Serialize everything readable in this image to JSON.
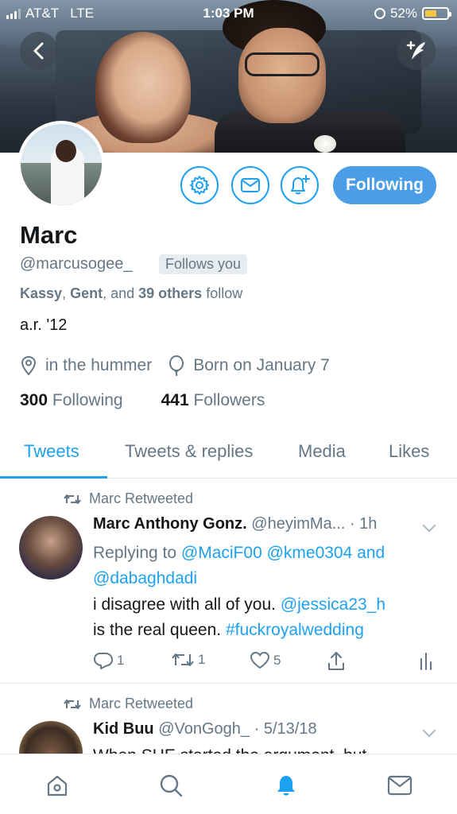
{
  "status_bar": {
    "carrier": "AT&T",
    "network": "LTE",
    "time": "1:03 PM",
    "battery_percent": "52%",
    "battery_level": 0.52
  },
  "profile": {
    "name": "Marc",
    "handle": "@marcusogee_",
    "follows_you": "Follows you",
    "followed_by": {
      "name1": "Kassy",
      "sep1": ",",
      "name2": "Gent",
      "sep2": ", and",
      "others": "39 others",
      "suffix": "follow"
    },
    "bio": "a.r. '12",
    "location": "in the hummer",
    "birthday": "Born on January 7",
    "following_count": "300",
    "following_label": "Following",
    "followers_count": "441",
    "followers_label": "Followers"
  },
  "actions": {
    "following_button": "Following"
  },
  "tabs": [
    {
      "label": "Tweets",
      "active": true
    },
    {
      "label": "Tweets & replies",
      "active": false
    },
    {
      "label": "Media",
      "active": false
    },
    {
      "label": "Likes",
      "active": false
    }
  ],
  "tweets": [
    {
      "retweeted_by": "Marc Retweeted",
      "name": "Marc Anthony Gonz.",
      "handle": "@heyimMa...",
      "time": "· 1h",
      "replying_label": "Replying to",
      "reply_mentions": "@MaciF00 @kme0304",
      "reply_and": "and",
      "reply_mention2": "@dabaghdadi",
      "text_part1": "i disagree with all of you.",
      "text_mention": "@jessica23_h",
      "text_part2": "is the real queen.",
      "text_hashtag": "#fuckroyalwedding",
      "replies": "1",
      "retweets": "1",
      "likes": "5"
    },
    {
      "retweeted_by": "Marc Retweeted",
      "name": "Kid Buu",
      "handle": "@VonGogh_",
      "time": "· 5/13/18",
      "text": "When SHE started the argument, but"
    }
  ],
  "colors": {
    "accent": "#1da1f2",
    "following_button": "#4a9de6",
    "secondary_text": "#657786",
    "battery": "#f5c543"
  },
  "icons": [
    "back-icon",
    "compose-icon",
    "gear-icon",
    "mail-icon",
    "bell-plus-icon",
    "location-pin-icon",
    "balloon-icon",
    "retweet-icon",
    "reply-icon",
    "heart-icon",
    "share-icon",
    "analytics-icon",
    "home-icon",
    "search-icon",
    "bell-icon",
    "mail-icon"
  ]
}
